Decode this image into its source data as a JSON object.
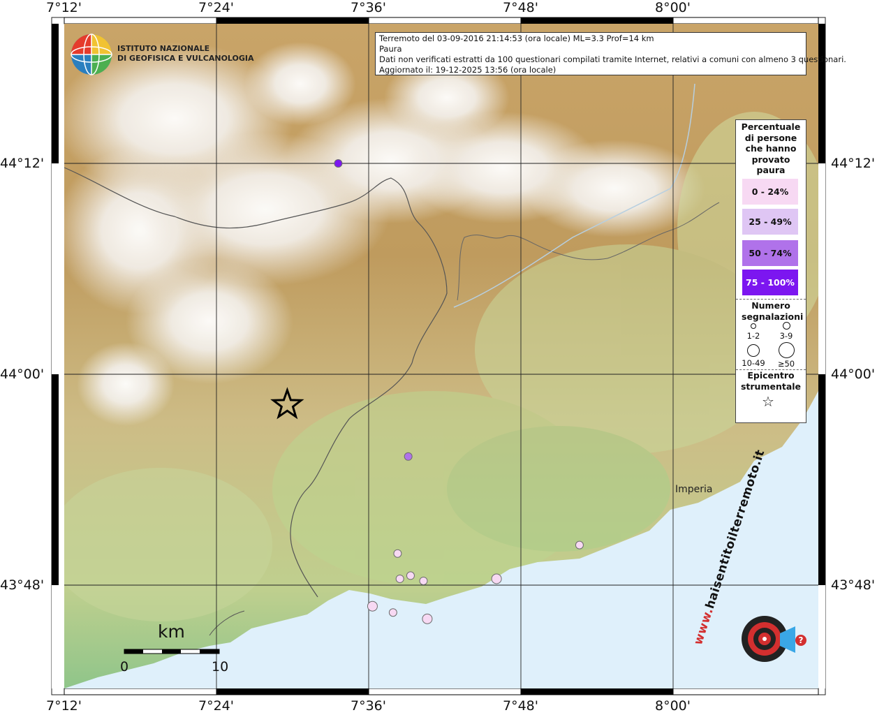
{
  "title_box": {
    "line1": "Terremoto del 03-09-2016 21:14:53 (ora locale) ML=3.3 Prof=14 km",
    "line2": "Paura",
    "line3": "Dati non verificati estratti da 100 questionari compilati tramite Internet, relativi a comuni con almeno 3 questionari.",
    "line4": "Aggiornato il: 19-12-2025 13:56 (ora locale)"
  },
  "logo": {
    "line1": "ISTITUTO NAZIONALE",
    "line2": "DI GEOFISICA E VULCANOLOGIA",
    "icon": "globe-icon"
  },
  "axes": {
    "lon_ticks": [
      "7°12'",
      "7°24'",
      "7°36'",
      "7°48'",
      "8°00'"
    ],
    "lat_ticks": [
      "44°12'",
      "44°00'",
      "43°48'"
    ]
  },
  "legend": {
    "title": "Percentuale di persone che hanno provato paura",
    "classes": [
      {
        "label": "0 - 24%",
        "color": "#f7d9f3"
      },
      {
        "label": "25 - 49%",
        "color": "#dfc6f4"
      },
      {
        "label": "50 - 74%",
        "color": "#b072ea"
      },
      {
        "label": "75 - 100%",
        "color": "#7c16f0"
      }
    ],
    "count_title": "Numero segnalazioni",
    "count_classes": [
      "1-2",
      "3-9",
      "10-49",
      "≥50"
    ],
    "epicenter_title": "Epicentro strumentale",
    "epicenter_icon": "star-icon"
  },
  "scale_bar": {
    "title": "km",
    "start": "0",
    "end": "10"
  },
  "places": {
    "imperia": "Imperia"
  },
  "badge": {
    "text": "haisentitoilterremoto.it",
    "prefix": "www.",
    "icon": "target-icon"
  },
  "observations": [
    {
      "lon": 7.56,
      "lat": 44.2,
      "class": 3,
      "count": "1-2"
    },
    {
      "lon": 7.652,
      "lat": 43.922,
      "class": 2,
      "count": "1-2"
    },
    {
      "lon": 7.877,
      "lat": 43.838,
      "class": 0,
      "count": "1-2"
    },
    {
      "lon": 7.638,
      "lat": 43.83,
      "class": 0,
      "count": "1-2"
    },
    {
      "lon": 7.641,
      "lat": 43.806,
      "class": 0,
      "count": "1-2"
    },
    {
      "lon": 7.655,
      "lat": 43.809,
      "class": 0,
      "count": "1-2"
    },
    {
      "lon": 7.672,
      "lat": 43.804,
      "class": 0,
      "count": "1-2"
    },
    {
      "lon": 7.768,
      "lat": 43.806,
      "class": 0,
      "count": "3-9"
    },
    {
      "lon": 7.605,
      "lat": 43.78,
      "class": 0,
      "count": "3-9"
    },
    {
      "lon": 7.632,
      "lat": 43.774,
      "class": 0,
      "count": "1-2"
    },
    {
      "lon": 7.677,
      "lat": 43.768,
      "class": 0,
      "count": "3-9"
    }
  ],
  "epicenter": {
    "lon": 7.493,
    "lat": 43.971
  }
}
